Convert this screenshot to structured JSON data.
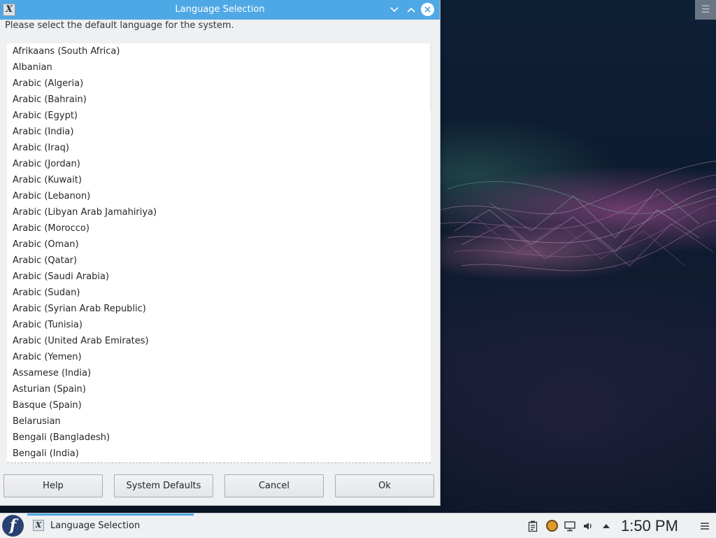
{
  "window": {
    "title": "Language Selection",
    "app_icon": "x-app-icon",
    "prompt": "Please select the default language for the system.",
    "languages": [
      "Afrikaans (South Africa)",
      "Albanian",
      "Arabic (Algeria)",
      "Arabic (Bahrain)",
      "Arabic (Egypt)",
      "Arabic (India)",
      "Arabic (Iraq)",
      "Arabic (Jordan)",
      "Arabic (Kuwait)",
      "Arabic (Lebanon)",
      "Arabic (Libyan Arab Jamahiriya)",
      "Arabic (Morocco)",
      "Arabic (Oman)",
      "Arabic (Qatar)",
      "Arabic (Saudi Arabia)",
      "Arabic (Sudan)",
      "Arabic (Syrian Arab Republic)",
      "Arabic (Tunisia)",
      "Arabic (United Arab Emirates)",
      "Arabic (Yemen)",
      "Assamese (India)",
      "Asturian (Spain)",
      "Basque (Spain)",
      "Belarusian",
      "Bengali (Bangladesh)",
      "Bengali (India)"
    ],
    "buttons": {
      "help": "Help",
      "defaults": "System Defaults",
      "cancel": "Cancel",
      "ok": "Ok"
    }
  },
  "taskbar": {
    "task_label": "Language Selection",
    "clock": "1:50 PM",
    "tray_icons": [
      "clipboard-icon",
      "update-icon",
      "network-icon",
      "volume-icon",
      "expand-tray-icon",
      "menu-icon"
    ]
  },
  "colors": {
    "titlebar": "#4fa8e6",
    "window_bg": "#eff0f1",
    "desktop_bg": "#0c1a2e"
  }
}
